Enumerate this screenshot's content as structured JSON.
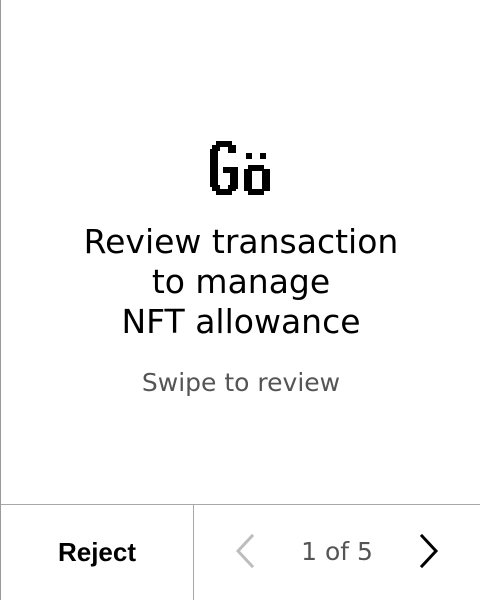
{
  "logo": {
    "text": "Gö",
    "icon": "ledger-go-logo"
  },
  "main": {
    "title_lines": [
      "Review transaction",
      "to manage",
      "NFT allowance"
    ],
    "subtitle": "Swipe to review"
  },
  "footer": {
    "reject_label": "Reject",
    "page_indicator": "1 of 5",
    "prev_icon": "chevron-left-icon",
    "next_icon": "chevron-right-icon",
    "prev_enabled": false,
    "next_enabled": true
  },
  "colors": {
    "background": "#ffffff",
    "text_primary": "#000000",
    "text_secondary": "#555555",
    "divider": "#a8a8a8",
    "disabled_icon": "#bdbdbd"
  }
}
